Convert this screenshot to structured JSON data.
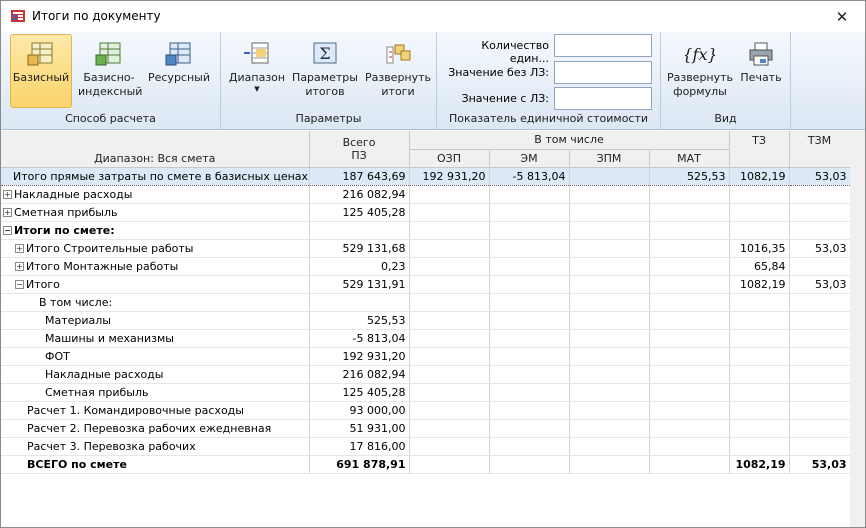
{
  "window": {
    "title": "Итоги по документу"
  },
  "ribbon": {
    "calc_group": {
      "label": "Способ расчета",
      "buttons": [
        "Базисный",
        "Базисно-индексный",
        "Ресурсный"
      ]
    },
    "params_group": {
      "label": "Параметры",
      "buttons": [
        "Диапазон",
        "Параметры итогов",
        "Развернуть итоги"
      ]
    },
    "unit_group": {
      "label": "Показатель единичной стоимости",
      "fields": [
        "Количество един...",
        "Значение без ЛЗ:",
        "Значение с ЛЗ:"
      ]
    },
    "view_group": {
      "label": "Вид",
      "buttons": [
        "Развернуть формулы",
        "Печать"
      ]
    }
  },
  "grid": {
    "headers": {
      "range": "Диапазон: Вся смета",
      "total": "Всего",
      "pz": "ПЗ",
      "incl": "В том числе",
      "ozp": "ОЗП",
      "em": "ЭМ",
      "zpm": "ЗПМ",
      "mat": "МАТ",
      "tz": "ТЗ",
      "tzm": "ТЗМ"
    },
    "rows": [
      [
        "Итого прямые затраты по смете в базисных ценах",
        "187 643,69",
        "192 931,20",
        "-5 813,04",
        "",
        "525,53",
        "1082,19",
        "53,03"
      ],
      [
        "Накладные расходы",
        "216 082,94",
        "",
        "",
        "",
        "",
        "",
        ""
      ],
      [
        "Сметная прибыль",
        "125 405,28",
        "",
        "",
        "",
        "",
        "",
        ""
      ],
      [
        "Итоги по смете:",
        "",
        "",
        "",
        "",
        "",
        "",
        ""
      ],
      [
        "Итого Строительные работы",
        "529 131,68",
        "",
        "",
        "",
        "",
        "1016,35",
        "53,03"
      ],
      [
        "Итого Монтажные работы",
        "0,23",
        "",
        "",
        "",
        "",
        "65,84",
        ""
      ],
      [
        "Итого",
        "529 131,91",
        "",
        "",
        "",
        "",
        "1082,19",
        "53,03"
      ],
      [
        "В том числе:",
        "",
        "",
        "",
        "",
        "",
        "",
        ""
      ],
      [
        "Материалы",
        "525,53",
        "",
        "",
        "",
        "",
        "",
        ""
      ],
      [
        "Машины и механизмы",
        "-5 813,04",
        "",
        "",
        "",
        "",
        "",
        ""
      ],
      [
        "ФОТ",
        "192 931,20",
        "",
        "",
        "",
        "",
        "",
        ""
      ],
      [
        "Накладные расходы",
        "216 082,94",
        "",
        "",
        "",
        "",
        "",
        ""
      ],
      [
        "Сметная прибыль",
        "125 405,28",
        "",
        "",
        "",
        "",
        "",
        ""
      ],
      [
        "Расчет 1.  Командировочные расходы",
        "93 000,00",
        "",
        "",
        "",
        "",
        "",
        ""
      ],
      [
        "Расчет 2.  Перевозка рабочих ежедневная",
        "51 931,00",
        "",
        "",
        "",
        "",
        "",
        ""
      ],
      [
        "Расчет 3.  Перевозка рабочих",
        "17 816,00",
        "",
        "",
        "",
        "",
        "",
        ""
      ],
      [
        "ВСЕГО по смете",
        "691 878,91",
        "",
        "",
        "",
        "",
        "1082,19",
        "53,03"
      ]
    ]
  }
}
